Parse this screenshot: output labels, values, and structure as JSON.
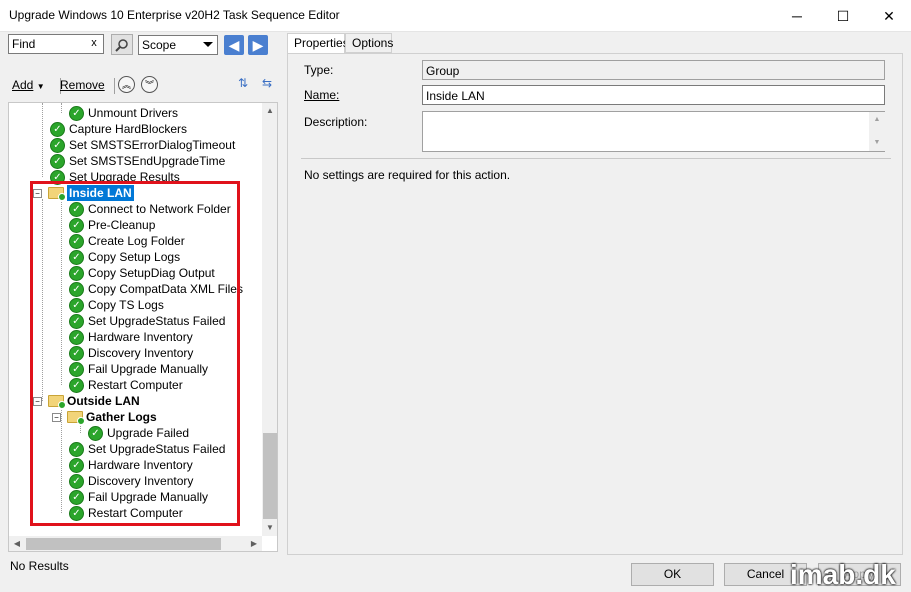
{
  "window": {
    "title": "Upgrade Windows 10 Enterprise v20H2 Task Sequence Editor",
    "minimize": "─",
    "maximize": "☐",
    "close": "✕"
  },
  "search": {
    "value": "Find",
    "clear": "x",
    "scope": "Scope"
  },
  "toolbar": {
    "add_label": "Add",
    "remove_label": "Remove"
  },
  "tree": {
    "items": [
      {
        "label": "Unmount Drivers"
      },
      {
        "label": "Capture HardBlockers"
      },
      {
        "label": "Set SMSTSErrorDialogTimeout"
      },
      {
        "label": "Set SMSTSEndUpgradeTime"
      },
      {
        "label": "Set Upgrade Results"
      },
      {
        "label": "Inside LAN"
      },
      {
        "label": "Connect to Network Folder"
      },
      {
        "label": "Pre-Cleanup"
      },
      {
        "label": "Create Log Folder"
      },
      {
        "label": "Copy Setup Logs"
      },
      {
        "label": "Copy SetupDiag Output"
      },
      {
        "label": "Copy CompatData XML Files"
      },
      {
        "label": "Copy TS Logs"
      },
      {
        "label": "Set UpgradeStatus Failed"
      },
      {
        "label": "Hardware Inventory"
      },
      {
        "label": "Discovery Inventory"
      },
      {
        "label": "Fail Upgrade Manually"
      },
      {
        "label": "Restart Computer"
      },
      {
        "label": "Outside LAN"
      },
      {
        "label": "Gather Logs"
      },
      {
        "label": "Upgrade Failed"
      },
      {
        "label": "Set UpgradeStatus Failed"
      },
      {
        "label": "Hardware Inventory"
      },
      {
        "label": "Discovery Inventory"
      },
      {
        "label": "Fail Upgrade Manually"
      },
      {
        "label": "Restart Computer"
      }
    ]
  },
  "tabs": {
    "properties": "Properties",
    "options": "Options"
  },
  "properties": {
    "type_label": "Type:",
    "type_value": "Group",
    "name_label": "Name:",
    "name_value": "Inside LAN",
    "description_label": "Description:",
    "description_value": "",
    "info": "No settings are required  for this action."
  },
  "status": "No Results",
  "buttons": {
    "ok": "OK",
    "cancel": "Cancel",
    "apply": "Apply"
  },
  "watermark": "imab.dk",
  "colors": {
    "selection": "#0078d7",
    "highlight_box": "#e0121b",
    "success_check": "#2ba52b"
  }
}
